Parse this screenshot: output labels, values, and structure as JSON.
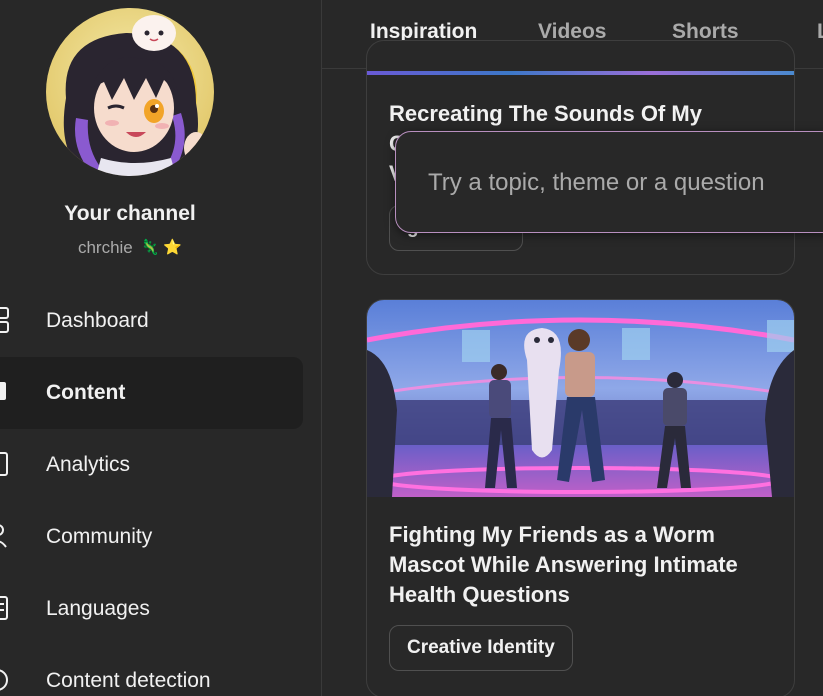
{
  "channel": {
    "title": "Your channel",
    "handle": "chrchie",
    "handle_emoji": "🦎 ⭐"
  },
  "sidebar": {
    "items": [
      {
        "label": "Dashboard",
        "icon": "dashboard-icon"
      },
      {
        "label": "Content",
        "icon": "content-icon",
        "active": true
      },
      {
        "label": "Analytics",
        "icon": "analytics-icon"
      },
      {
        "label": "Community",
        "icon": "community-icon"
      },
      {
        "label": "Languages",
        "icon": "languages-icon"
      },
      {
        "label": "Content detection",
        "icon": "content-detection-icon"
      }
    ]
  },
  "tabs": [
    {
      "label": "Inspiration",
      "active": true
    },
    {
      "label": "Videos"
    },
    {
      "label": "Shorts"
    },
    {
      "label": "L"
    }
  ],
  "cards": [
    {
      "title_line1": "Recreating The Sounds Of My",
      "title_line2_fragment": "C",
      "title_line3_fragment": "V",
      "chip": "g"
    },
    {
      "title_lines": [
        "Fighting My Friends as a Worm",
        "Mascot While Answering Intimate",
        "Health Questions"
      ],
      "chip": "Creative Identity"
    }
  ],
  "search": {
    "placeholder": "Try a topic, theme or a question",
    "value": ""
  },
  "colors": {
    "background": "#282828",
    "active_nav": "#1f1f1f",
    "search_border": "#b88fbf",
    "muted_text": "#aaaaaa"
  }
}
